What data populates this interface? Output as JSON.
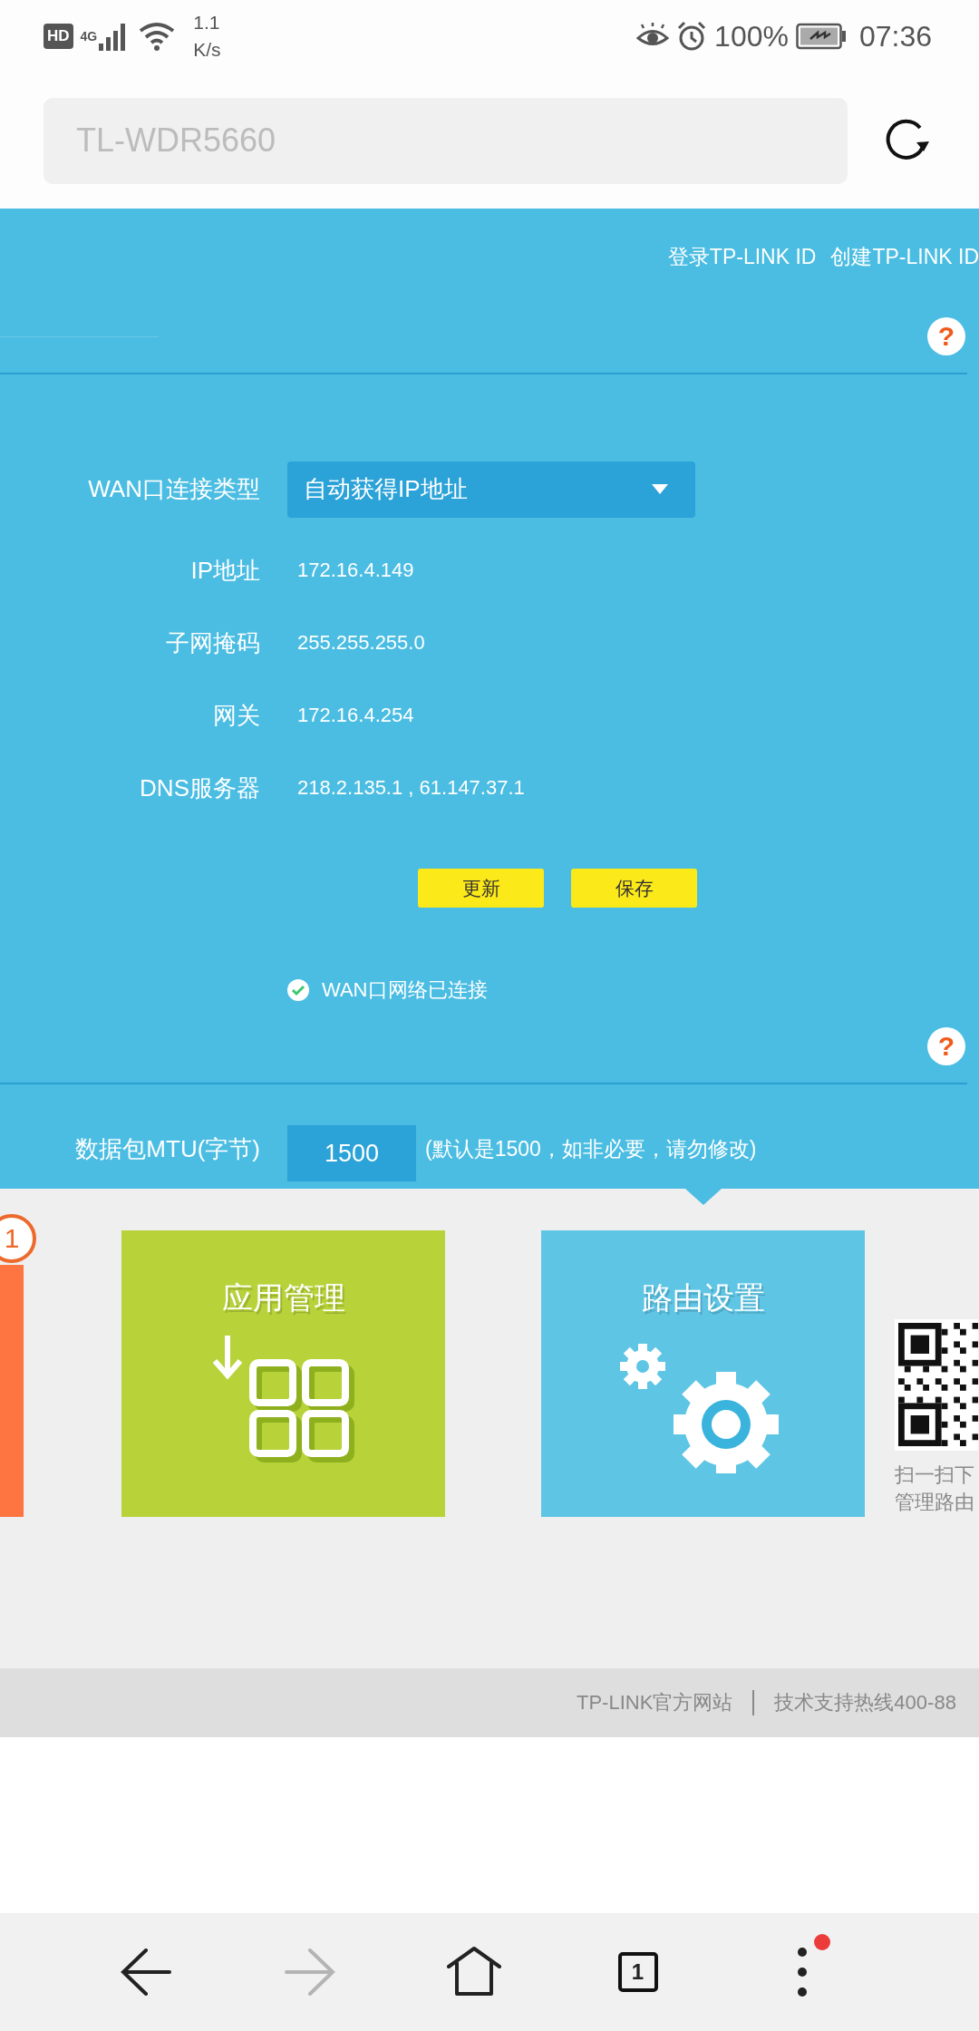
{
  "status_bar": {
    "hd_label": "HD",
    "network": "4G",
    "speed_value": "1.1",
    "speed_unit": "K/s",
    "battery": "100%",
    "time": "07:36"
  },
  "address_bar": {
    "placeholder": "TL-WDR5660"
  },
  "header_links": [
    "登录TP-LINK ID",
    "创建TP-LINK ID"
  ],
  "wan_settings": {
    "help_mark": "?",
    "fields": [
      {
        "kind": "select",
        "label": "WAN口连接类型",
        "value": "自动获得IP地址"
      },
      {
        "kind": "text",
        "label": "IP地址",
        "value": "172.16.4.149"
      },
      {
        "kind": "text",
        "label": "子网掩码",
        "value": "255.255.255.0"
      },
      {
        "kind": "text",
        "label": "网关",
        "value": "172.16.4.254"
      },
      {
        "kind": "text",
        "label": "DNS服务器",
        "value": "218.2.135.1 , 61.147.37.1"
      }
    ],
    "buttons": [
      "更新",
      "保存"
    ],
    "status": {
      "connected": true,
      "text": "WAN口网络已连接"
    }
  },
  "mtu": {
    "help_mark": "?",
    "label": "数据包MTU(字节)",
    "value": "1500",
    "hint": "(默认是1500，如非必要，请勿修改)"
  },
  "tiles": [
    {
      "kind": "badge",
      "badge": "1"
    },
    {
      "kind": "apps",
      "title": "应用管理"
    },
    {
      "kind": "router",
      "title": "路由设置"
    }
  ],
  "qr_caption": [
    "扫一扫下",
    "管理路由"
  ],
  "footer": {
    "links": [
      "TP-LINK官方网站",
      "技术支持热线400-88"
    ]
  },
  "nav": {
    "tab_count": "1",
    "forward_disabled": true,
    "menu_notification": true
  }
}
